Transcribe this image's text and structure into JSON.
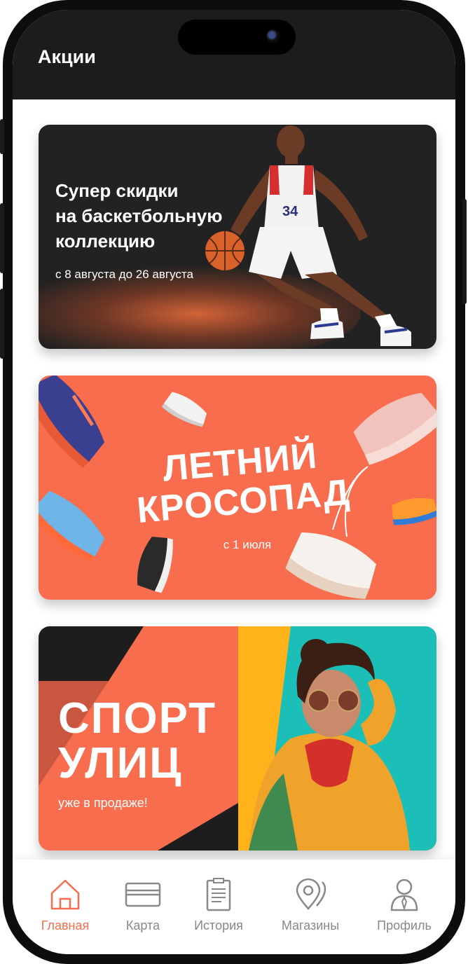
{
  "app": {
    "page_title": "Акции"
  },
  "colors": {
    "accent": "#f76d4d",
    "header_bg": "#1c1c1c",
    "inactive_tab": "#888888"
  },
  "promos": [
    {
      "title_line1": "Супер скидки",
      "title_line2": "на баскетбольную",
      "title_line3": "коллекцию",
      "dates": "с 8 августа до 26 августа"
    },
    {
      "title_line1": "ЛЕТНИЙ",
      "title_line2": "КРОСОПАД",
      "dates": "с 1 июля"
    },
    {
      "title_line1": "СПОРТ",
      "title_line2": "УЛИЦ",
      "subtitle": "уже в продаже!"
    }
  ],
  "tabbar": {
    "active": "home",
    "items": [
      {
        "icon": "home-icon",
        "label": "Главная"
      },
      {
        "icon": "card-icon",
        "label": "Карта"
      },
      {
        "icon": "receipt-icon",
        "label": "История"
      },
      {
        "icon": "map-pin-icon",
        "label": "Магазины"
      },
      {
        "icon": "user-icon",
        "label": "Профиль"
      }
    ]
  }
}
